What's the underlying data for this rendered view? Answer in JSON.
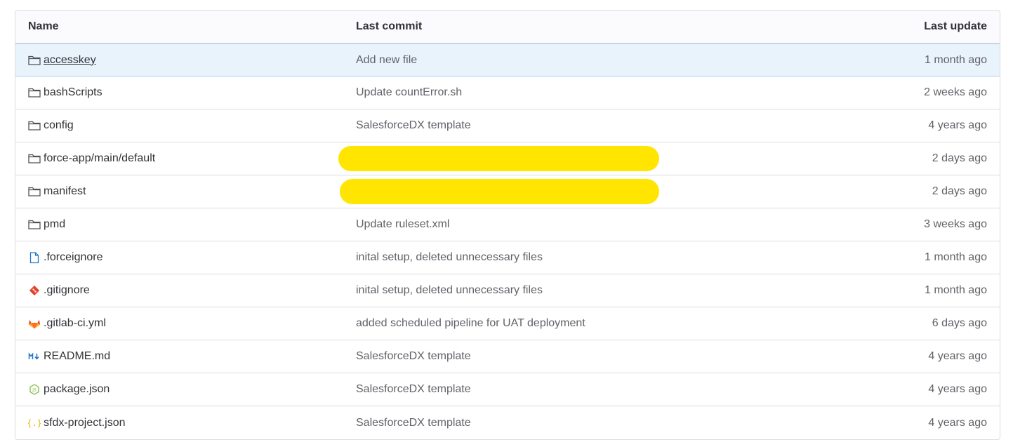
{
  "header": {
    "name": "Name",
    "last_commit": "Last commit",
    "last_update": "Last update"
  },
  "colors": {
    "redaction": "#ffe500",
    "row_highlight": "#e9f3fc",
    "border": "#dcdcde"
  },
  "rows": [
    {
      "name": "accesskey",
      "icon": "folder-icon",
      "commit": "Add new file",
      "update": "1 month ago"
    },
    {
      "name": "bashScripts",
      "icon": "folder-icon",
      "commit": "Update countError.sh",
      "update": "2 weeks ago"
    },
    {
      "name": "config",
      "icon": "folder-icon",
      "commit": "SalesforceDX template",
      "update": "4 years ago"
    },
    {
      "name": "force-app/main/default",
      "icon": "folder-icon",
      "commit": "",
      "commit_redacted": true,
      "update": "2 days ago"
    },
    {
      "name": "manifest",
      "icon": "folder-icon",
      "commit": "",
      "commit_redacted": true,
      "update": "2 days ago"
    },
    {
      "name": "pmd",
      "icon": "folder-icon",
      "commit": "Update ruleset.xml",
      "update": "3 weeks ago"
    },
    {
      "name": ".forceignore",
      "icon": "file-icon",
      "commit": "inital setup, deleted unnecessary files",
      "update": "1 month ago"
    },
    {
      "name": ".gitignore",
      "icon": "git-icon",
      "commit": "inital setup, deleted unnecessary files",
      "update": "1 month ago"
    },
    {
      "name": ".gitlab-ci.yml",
      "icon": "gitlab-icon",
      "commit": "added scheduled pipeline for UAT deployment",
      "update": "6 days ago"
    },
    {
      "name": "README.md",
      "icon": "markdown-icon",
      "commit": "SalesforceDX template",
      "update": "4 years ago"
    },
    {
      "name": "package.json",
      "icon": "nodejs-icon",
      "commit": "SalesforceDX template",
      "update": "4 years ago"
    },
    {
      "name": "sfdx-project.json",
      "icon": "json-icon",
      "commit": "SalesforceDX template",
      "update": "4 years ago"
    }
  ]
}
